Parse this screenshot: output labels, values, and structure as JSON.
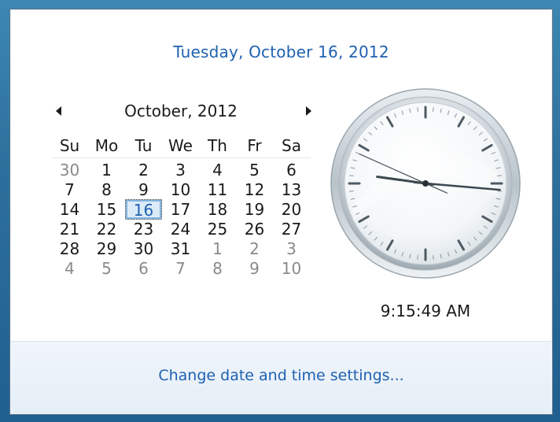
{
  "header": {
    "date_text": "Tuesday, October 16, 2012"
  },
  "calendar": {
    "month_title": "October, 2012",
    "prev_month_label": "previous month",
    "next_month_label": "next month",
    "weekdays": [
      "Su",
      "Mo",
      "Tu",
      "We",
      "Th",
      "Fr",
      "Sa"
    ],
    "weeks": [
      [
        "30",
        "1",
        "2",
        "3",
        "4",
        "5",
        "6"
      ],
      [
        "7",
        "8",
        "9",
        "10",
        "11",
        "12",
        "13"
      ],
      [
        "14",
        "15",
        "16",
        "17",
        "18",
        "19",
        "20"
      ],
      [
        "21",
        "22",
        "23",
        "24",
        "25",
        "26",
        "27"
      ],
      [
        "28",
        "29",
        "30",
        "31",
        "1",
        "2",
        "3"
      ],
      [
        "4",
        "5",
        "6",
        "7",
        "8",
        "9",
        "10"
      ]
    ],
    "muted_cells": [
      [
        0,
        0
      ],
      [
        4,
        4
      ],
      [
        4,
        5
      ],
      [
        4,
        6
      ],
      [
        5,
        0
      ],
      [
        5,
        1
      ],
      [
        5,
        2
      ],
      [
        5,
        3
      ],
      [
        5,
        4
      ],
      [
        5,
        5
      ],
      [
        5,
        6
      ]
    ],
    "today": [
      2,
      2
    ]
  },
  "clock": {
    "time_text": "9:15:49 AM",
    "hour": 9,
    "minute": 15,
    "second": 49
  },
  "footer": {
    "settings_link": "Change date and time settings..."
  },
  "colors": {
    "link": "#1e61b0",
    "text": "#1a1a1a",
    "muted_text": "#8a8a8a",
    "today_highlight": "#dcebf8"
  }
}
